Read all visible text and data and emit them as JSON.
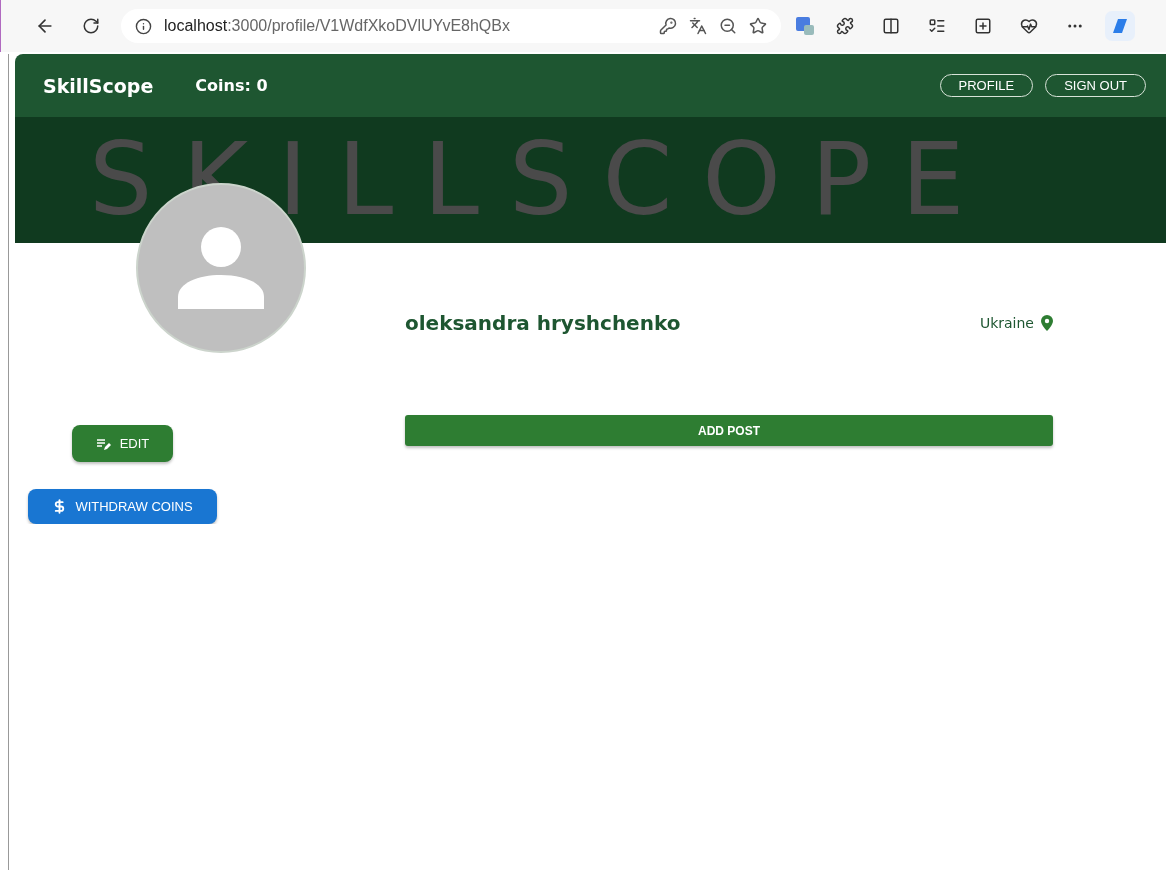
{
  "browser": {
    "url_host": "localhost",
    "url_path": ":3000/profile/V1WdfXkoDVlUYvE8hQBx"
  },
  "header": {
    "brand": "SkillScope",
    "coins": "Coins: 0",
    "buttons": [
      "PROFILE",
      "SIGN OUT"
    ]
  },
  "banner": {
    "watermark": "SKILLSCOPE"
  },
  "profile": {
    "name": "oleksandra hryshchenko",
    "location": "Ukraine",
    "actions": [
      {
        "label": "EDIT",
        "kind": "edit"
      },
      {
        "label": "WITHDRAW COINS",
        "kind": "withdraw"
      }
    ],
    "add_post": "ADD POST"
  }
}
